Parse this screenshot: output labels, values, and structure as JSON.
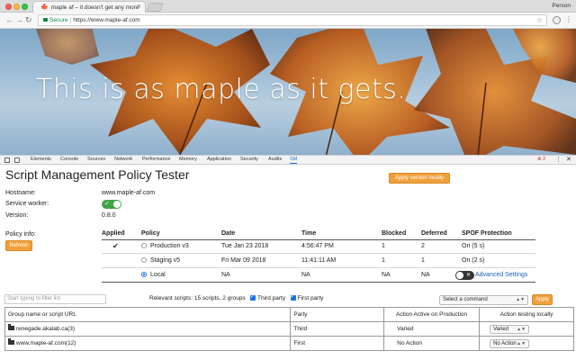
{
  "browser": {
    "tab_title": "maple af – it doesn't get any more",
    "tab_favicon": "maple-leaf-icon",
    "profile": "Person",
    "secure_label": "Secure",
    "url": "https://www.maple-af.com"
  },
  "hero": {
    "text": "This is as maple as it gets."
  },
  "devtools": {
    "tabs": [
      "Elements",
      "Console",
      "Sources",
      "Network",
      "Performance",
      "Memory",
      "Application",
      "Security",
      "Audits",
      "SM"
    ],
    "active_tab": "SM",
    "error_count": "2"
  },
  "panel": {
    "title": "Script Management Policy Tester",
    "apply_version_label": "Apply version locally",
    "hostname_label": "Hostname:",
    "hostname_value": "www.maple-af.com",
    "sw_label": "Service worker:",
    "version_label": "Version:",
    "version_value": "0.8.0",
    "policy_info_label": "Policy info:",
    "refresh_label": "Refresh",
    "policy_headers": {
      "applied": "Applied",
      "policy": "Policy",
      "date": "Date",
      "time": "Time",
      "blocked": "Blocked",
      "deferred": "Deferred",
      "spof": "SPOF Protection"
    },
    "policies": [
      {
        "applied": "✔",
        "name": "Production v3",
        "date": "Tue Jan 23 2018",
        "time": "4:56:47 PM",
        "blocked": "1",
        "deferred": "2",
        "spof": "On (5 s)"
      },
      {
        "applied": "",
        "name": "Staging v5",
        "date": "Fri Mar 09 2018",
        "time": "11:41:11 AM",
        "blocked": "1",
        "deferred": "1",
        "spof": "On (2 s)"
      },
      {
        "applied": "",
        "name": "Local",
        "date": "NA",
        "time": "NA",
        "blocked": "NA",
        "deferred": "NA",
        "spof": ""
      }
    ],
    "advanced_settings": "Advanced Settings",
    "filter_placeholder": "Start typing to filter list",
    "relevant_scripts": "Relevant scripts: 15 scripts, 2 groups",
    "third_party": "Third party",
    "first_party": "First party",
    "command_select": "Select a command",
    "apply_label": "Apply",
    "group_headers": {
      "name": "Group name or script URL",
      "party": "Party",
      "action_prod": "Action Active on Production",
      "action_local": "Action testing locally"
    },
    "groups": [
      {
        "name": "renegade.akalab.ca(3)",
        "party": "Third",
        "action_prod": "Varied",
        "action_local": "Varied"
      },
      {
        "name": "www.maple-af.com(12)",
        "party": "First",
        "action_prod": "No Action",
        "action_local": "No Action"
      }
    ]
  },
  "colors": {
    "accent_orange": "#f0a03c",
    "toggle_green": "#3ea644",
    "link_blue": "#1a5fb4"
  }
}
